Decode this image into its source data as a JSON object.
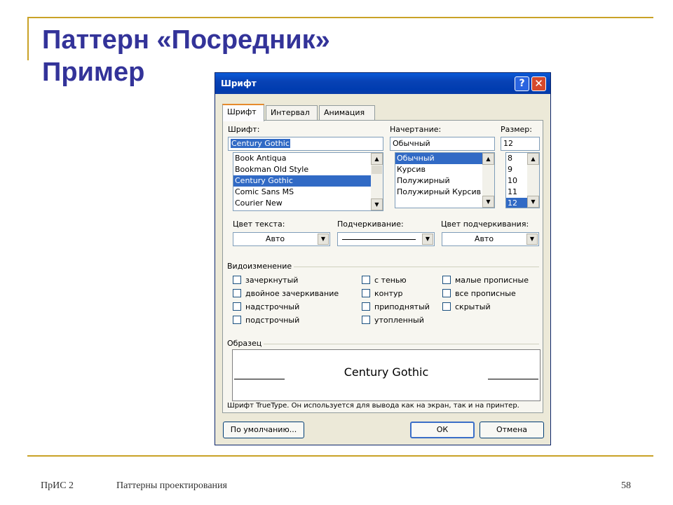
{
  "slide": {
    "title_line1": "Паттерн «Посредник»",
    "title_line2": "Пример",
    "footer_left": "ПрИС 2",
    "footer_center": "Паттерны проектирования",
    "page_number": "58",
    "accent_color": "#c9a227",
    "title_color": "#333399"
  },
  "dialog": {
    "title": "Шрифт",
    "help_label": "?",
    "close_label": "✕",
    "tabs": [
      {
        "label": "Шрифт",
        "active": true
      },
      {
        "label": "Интервал",
        "active": false
      },
      {
        "label": "Анимация",
        "active": false
      }
    ],
    "font": {
      "label": "Шрифт:",
      "value": "Century Gothic",
      "items": [
        "Book Antiqua",
        "Bookman Old Style",
        "Century Gothic",
        "Comic Sans MS",
        "Courier New"
      ],
      "selected": "Century Gothic"
    },
    "style": {
      "label": "Начертание:",
      "value": "Обычный",
      "items": [
        "Обычный",
        "Курсив",
        "Полужирный",
        "Полужирный Курсив"
      ],
      "selected": "Обычный"
    },
    "size": {
      "label": "Размер:",
      "value": "12",
      "items": [
        "8",
        "9",
        "10",
        "11",
        "12"
      ],
      "selected": "12"
    },
    "color": {
      "label": "Цвет текста:",
      "value": "Авто"
    },
    "underline": {
      "label": "Подчеркивание:",
      "value": ""
    },
    "underline_color": {
      "label": "Цвет подчеркивания:",
      "value": "Авто"
    },
    "effects": {
      "title": "Видоизменение",
      "items": [
        {
          "label": "зачеркнутый",
          "checked": false
        },
        {
          "label": "двойное зачеркивание",
          "checked": false
        },
        {
          "label": "надстрочный",
          "checked": false
        },
        {
          "label": "подстрочный",
          "checked": false
        },
        {
          "label": "с тенью",
          "checked": false
        },
        {
          "label": "контур",
          "checked": false
        },
        {
          "label": "приподнятый",
          "checked": false
        },
        {
          "label": "утопленный",
          "checked": false
        },
        {
          "label": "малые прописные",
          "checked": false
        },
        {
          "label": "все прописные",
          "checked": false
        },
        {
          "label": "скрытый",
          "checked": false
        }
      ]
    },
    "sample": {
      "title": "Образец",
      "text": "Century Gothic",
      "hint": "Шрифт TrueType. Он используется для вывода как на экран, так и на принтер."
    },
    "buttons": {
      "default": "По умолчанию...",
      "ok": "ОК",
      "cancel": "Отмена"
    }
  }
}
